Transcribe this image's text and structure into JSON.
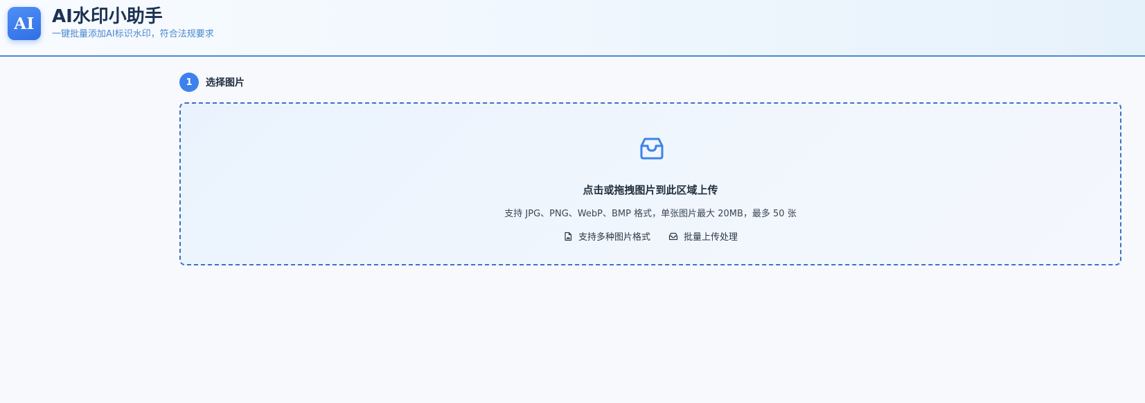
{
  "header": {
    "logo_text": "AI",
    "title": "AI水印小助手",
    "subtitle": "一键批量添加AI标识水印，符合法规要求"
  },
  "step": {
    "number": "1",
    "title": "选择图片"
  },
  "upload": {
    "icon": "inbox-icon",
    "main_text": "点击或拖拽图片到此区域上传",
    "hint": "支持 JPG、PNG、WebP、BMP 格式，单张图片最大 20MB，最多 50 张",
    "features": [
      {
        "icon": "file-image-icon",
        "label": "支持多种图片格式"
      },
      {
        "icon": "inbox-icon",
        "label": "批量上传处理"
      }
    ]
  },
  "colors": {
    "accent": "#3d82ec",
    "border": "#3d6fc9",
    "subtitle": "#4a86cf"
  }
}
